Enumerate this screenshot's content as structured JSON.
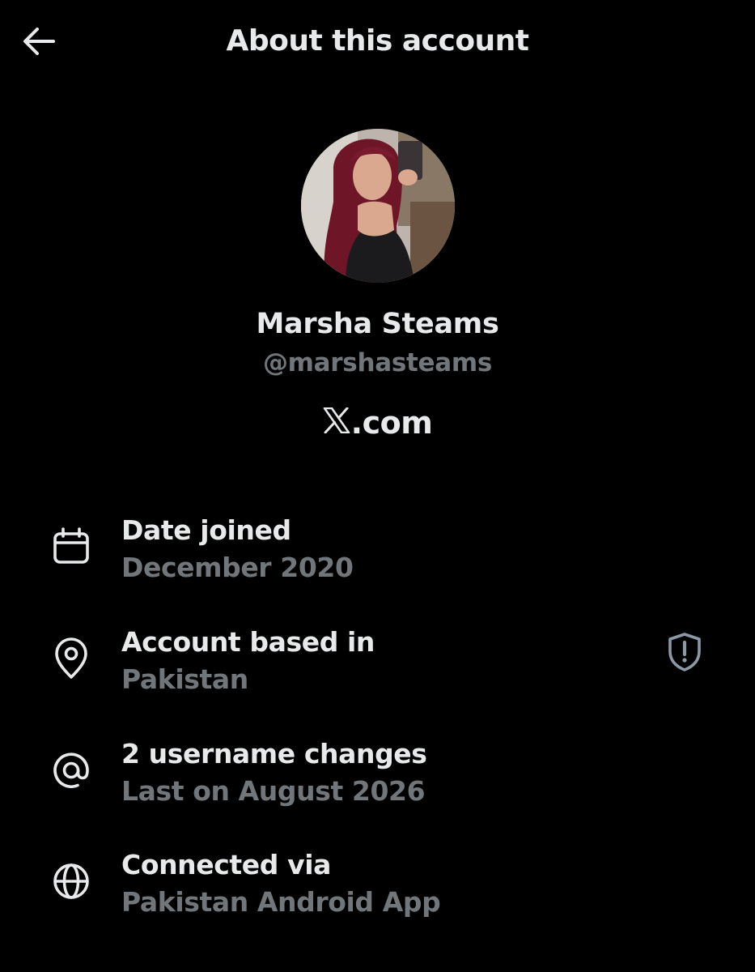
{
  "header": {
    "title": "About this account",
    "back_icon": "arrow-left-icon"
  },
  "profile": {
    "display_name": "Marsha Steams",
    "handle": "@marshasteams",
    "site_suffix": ".com",
    "site_logo": "x-logo-icon"
  },
  "details": [
    {
      "icon": "calendar-icon",
      "label": "Date joined",
      "value": "December 2020"
    },
    {
      "icon": "location-pin-icon",
      "label": "Account based in",
      "value": "Pakistan",
      "action_icon": "shield-alert-icon"
    },
    {
      "icon": "at-sign-icon",
      "label": "2 username changes",
      "value": "Last on August 2026"
    },
    {
      "icon": "globe-icon",
      "label": "Connected via",
      "value": "Pakistan Android App"
    }
  ],
  "colors": {
    "background": "#000000",
    "primary_text": "#e7e9ea",
    "secondary_text": "#71767b",
    "icon": "#e7e9ea",
    "action_icon": "#8b98a5"
  }
}
